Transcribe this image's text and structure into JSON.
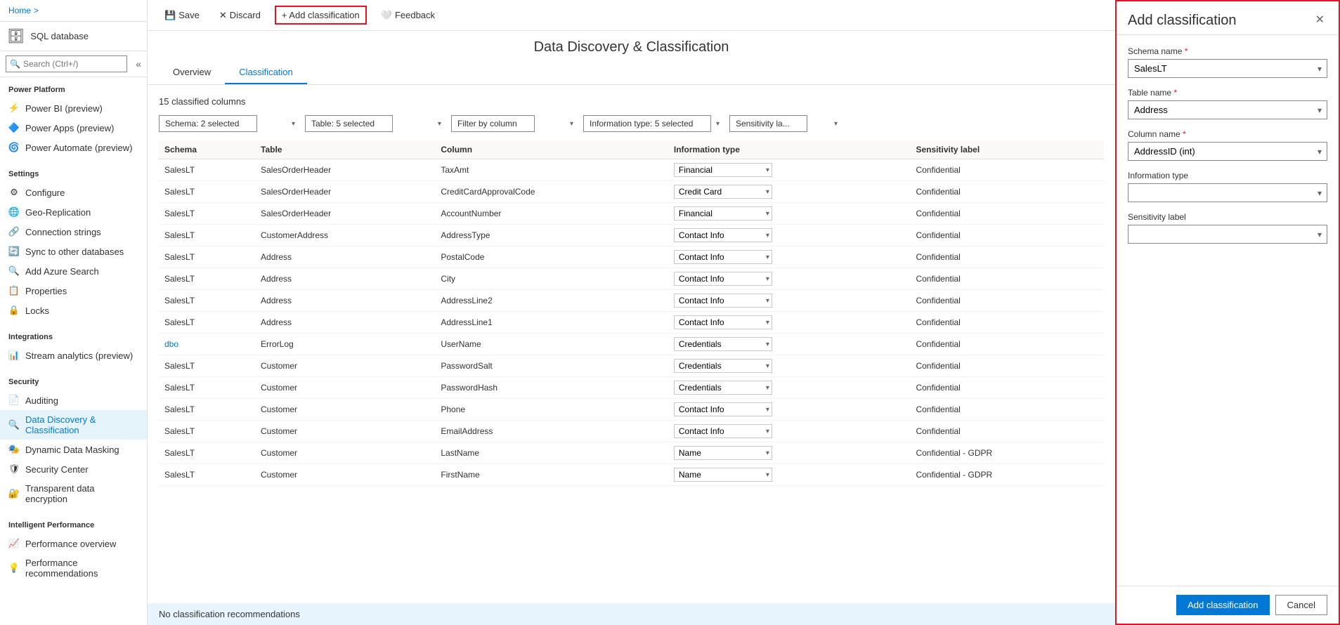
{
  "breadcrumb": {
    "home": "Home",
    "separator": ">"
  },
  "sidebar": {
    "app_icon": "🗄",
    "app_title": "SQL database",
    "search_placeholder": "Search (Ctrl+/)",
    "sections": [
      {
        "title": "Power Platform",
        "items": [
          {
            "id": "power-bi",
            "label": "Power BI (preview)",
            "icon": "⚡"
          },
          {
            "id": "power-apps",
            "label": "Power Apps (preview)",
            "icon": "🔷"
          },
          {
            "id": "power-automate",
            "label": "Power Automate (preview)",
            "icon": "🌀"
          }
        ]
      },
      {
        "title": "Settings",
        "items": [
          {
            "id": "configure",
            "label": "Configure",
            "icon": "⚙"
          },
          {
            "id": "geo-replication",
            "label": "Geo-Replication",
            "icon": "🌐"
          },
          {
            "id": "connection-strings",
            "label": "Connection strings",
            "icon": "🔗"
          },
          {
            "id": "sync",
            "label": "Sync to other databases",
            "icon": "🔄"
          },
          {
            "id": "azure-search",
            "label": "Add Azure Search",
            "icon": "🔍"
          },
          {
            "id": "properties",
            "label": "Properties",
            "icon": "📋"
          },
          {
            "id": "locks",
            "label": "Locks",
            "icon": "🔒"
          }
        ]
      },
      {
        "title": "Integrations",
        "items": [
          {
            "id": "stream-analytics",
            "label": "Stream analytics (preview)",
            "icon": "📊"
          }
        ]
      },
      {
        "title": "Security",
        "items": [
          {
            "id": "auditing",
            "label": "Auditing",
            "icon": "📄"
          },
          {
            "id": "data-discovery",
            "label": "Data Discovery & Classification",
            "icon": "🔍",
            "active": true
          },
          {
            "id": "dynamic-masking",
            "label": "Dynamic Data Masking",
            "icon": "🎭"
          },
          {
            "id": "security-center",
            "label": "Security Center",
            "icon": "🛡"
          },
          {
            "id": "tde",
            "label": "Transparent data encryption",
            "icon": "🔐"
          }
        ]
      },
      {
        "title": "Intelligent Performance",
        "items": [
          {
            "id": "perf-overview",
            "label": "Performance overview",
            "icon": "📈"
          },
          {
            "id": "perf-recommendations",
            "label": "Performance recommendations",
            "icon": "💡"
          }
        ]
      }
    ]
  },
  "toolbar": {
    "save_label": "Save",
    "discard_label": "Discard",
    "add_classification_label": "+ Add classification",
    "feedback_label": "Feedback"
  },
  "page": {
    "title": "Data Discovery & Classification",
    "tabs": [
      {
        "id": "overview",
        "label": "Overview"
      },
      {
        "id": "classification",
        "label": "Classification",
        "active": true
      }
    ],
    "classified_count": "15 classified columns"
  },
  "filters": {
    "schema": "Schema: 2 selected",
    "table": "Table: 5 selected",
    "column": "Filter by column",
    "info_type": "Information type: 5 selected",
    "sensitivity": "Sensitivity la..."
  },
  "table": {
    "headers": [
      "Schema",
      "Table",
      "Column",
      "Information type",
      "Sensitivity label"
    ],
    "rows": [
      {
        "schema": "SalesLT",
        "table": "SalesOrderHeader",
        "column": "TaxAmt",
        "info_type": "Financial",
        "sensitivity": "Confidential",
        "schema_link": false
      },
      {
        "schema": "SalesLT",
        "table": "SalesOrderHeader",
        "column": "CreditCardApprovalCode",
        "info_type": "Credit Card",
        "sensitivity": "Confidential",
        "schema_link": false
      },
      {
        "schema": "SalesLT",
        "table": "SalesOrderHeader",
        "column": "AccountNumber",
        "info_type": "Financial",
        "sensitivity": "Confidential",
        "schema_link": false
      },
      {
        "schema": "SalesLT",
        "table": "CustomerAddress",
        "column": "AddressType",
        "info_type": "Contact Info",
        "sensitivity": "Confidential",
        "schema_link": false
      },
      {
        "schema": "SalesLT",
        "table": "Address",
        "column": "PostalCode",
        "info_type": "Contact Info",
        "sensitivity": "Confidential",
        "schema_link": false
      },
      {
        "schema": "SalesLT",
        "table": "Address",
        "column": "City",
        "info_type": "Contact Info",
        "sensitivity": "Confidential",
        "schema_link": false
      },
      {
        "schema": "SalesLT",
        "table": "Address",
        "column": "AddressLine2",
        "info_type": "Contact Info",
        "sensitivity": "Confidential",
        "schema_link": false
      },
      {
        "schema": "SalesLT",
        "table": "Address",
        "column": "AddressLine1",
        "info_type": "Contact Info",
        "sensitivity": "Confidential",
        "schema_link": false
      },
      {
        "schema": "dbo",
        "table": "ErrorLog",
        "column": "UserName",
        "info_type": "Credentials",
        "sensitivity": "Confidential",
        "schema_link": true
      },
      {
        "schema": "SalesLT",
        "table": "Customer",
        "column": "PasswordSalt",
        "info_type": "Credentials",
        "sensitivity": "Confidential",
        "schema_link": false
      },
      {
        "schema": "SalesLT",
        "table": "Customer",
        "column": "PasswordHash",
        "info_type": "Credentials",
        "sensitivity": "Confidential",
        "schema_link": false
      },
      {
        "schema": "SalesLT",
        "table": "Customer",
        "column": "Phone",
        "info_type": "Contact Info",
        "sensitivity": "Confidential",
        "schema_link": false
      },
      {
        "schema": "SalesLT",
        "table": "Customer",
        "column": "EmailAddress",
        "info_type": "Contact Info",
        "sensitivity": "Confidential",
        "schema_link": false
      },
      {
        "schema": "SalesLT",
        "table": "Customer",
        "column": "LastName",
        "info_type": "Name",
        "sensitivity": "Confidential - GDPR",
        "schema_link": false
      },
      {
        "schema": "SalesLT",
        "table": "Customer",
        "column": "FirstName",
        "info_type": "Name",
        "sensitivity": "Confidential - GDPR",
        "schema_link": false
      }
    ]
  },
  "no_recommendations": "No classification recommendations",
  "right_panel": {
    "title": "Add classification",
    "fields": {
      "schema_name_label": "Schema name",
      "schema_name_value": "SalesLT",
      "table_name_label": "Table name",
      "table_name_value": "Address",
      "column_name_label": "Column name",
      "column_name_value": "AddressID (int)",
      "info_type_label": "Information type",
      "info_type_value": "",
      "sensitivity_label_label": "Sensitivity label",
      "sensitivity_label_value": ""
    },
    "add_btn": "Add classification",
    "cancel_btn": "Cancel"
  }
}
